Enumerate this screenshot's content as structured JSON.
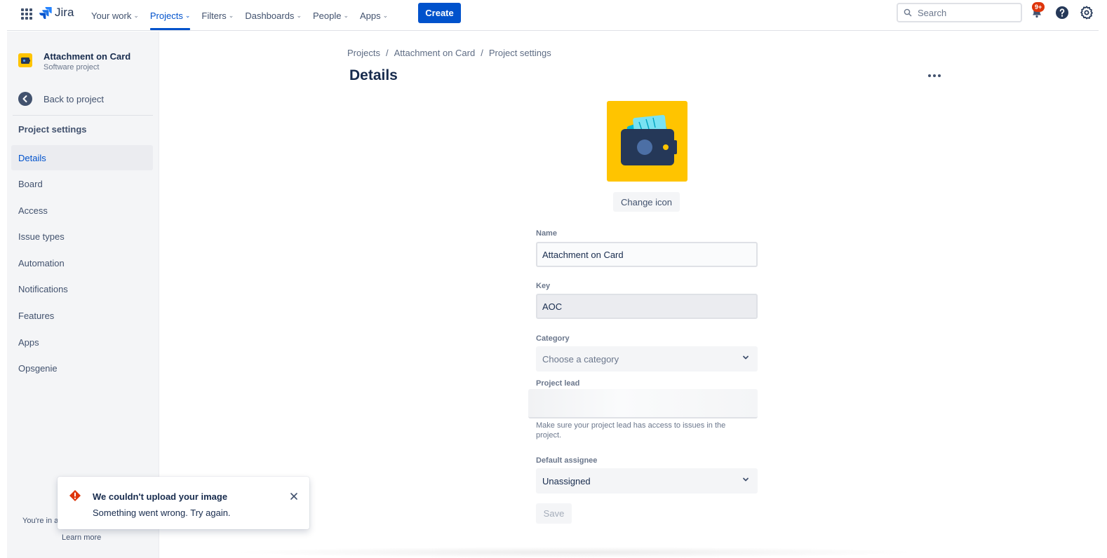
{
  "topnav": {
    "logo_text": "Jira",
    "items": [
      {
        "label": "Your work",
        "active": false
      },
      {
        "label": "Projects",
        "active": true
      },
      {
        "label": "Filters",
        "active": false
      },
      {
        "label": "Dashboards",
        "active": false
      },
      {
        "label": "People",
        "active": false
      },
      {
        "label": "Apps",
        "active": false
      }
    ],
    "create_label": "Create",
    "search_placeholder": "Search",
    "notifications_badge": "9+",
    "icons": [
      "app-switcher-icon",
      "jira-logo-icon",
      "search-icon",
      "notifications-icon",
      "help-icon",
      "settings-icon"
    ]
  },
  "sidebar": {
    "project_name": "Attachment on Card",
    "project_type": "Software project",
    "back_label": "Back to project",
    "heading": "Project settings",
    "items": [
      {
        "label": "Details",
        "active": true
      },
      {
        "label": "Board",
        "active": false
      },
      {
        "label": "Access",
        "active": false
      },
      {
        "label": "Issue types",
        "active": false
      },
      {
        "label": "Automation",
        "active": false
      },
      {
        "label": "Notifications",
        "active": false
      },
      {
        "label": "Features",
        "active": false
      },
      {
        "label": "Apps",
        "active": false
      },
      {
        "label": "Opsgenie",
        "active": false
      }
    ],
    "footer_text": "You're in a",
    "footer_link": "Learn more"
  },
  "main": {
    "breadcrumbs": [
      "Projects",
      "Attachment on Card",
      "Project settings"
    ],
    "breadcrumb_separator": "/",
    "title": "Details",
    "change_icon_label": "Change icon",
    "form": {
      "name_label": "Name",
      "name_value": "Attachment on Card",
      "key_label": "Key",
      "key_value": "AOC",
      "category_label": "Category",
      "category_placeholder": "Choose a category",
      "lead_label": "Project lead",
      "lead_help": "Make sure your project lead has access to issues in the project.",
      "assignee_label": "Default assignee",
      "assignee_value": "Unassigned",
      "save_label": "Save"
    }
  },
  "flag": {
    "title": "We couldn't upload your image",
    "description": "Something went wrong. Try again."
  },
  "colors": {
    "primary": "#0052cc",
    "project_icon_bg": "#ffc400",
    "error": "#de350b",
    "text": "#172b4d"
  }
}
